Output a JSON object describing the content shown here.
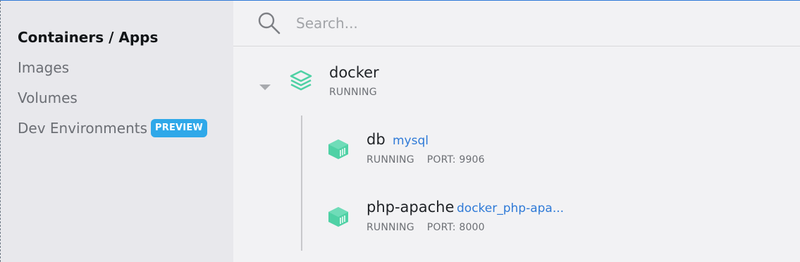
{
  "sidebar": {
    "items": [
      {
        "label": "Containers / Apps",
        "active": true
      },
      {
        "label": "Images",
        "active": false
      },
      {
        "label": "Volumes",
        "active": false
      },
      {
        "label": "Dev Environments",
        "active": false,
        "badge": "PREVIEW"
      }
    ]
  },
  "search": {
    "placeholder": "Search...",
    "icon": "search-icon"
  },
  "app": {
    "name": "docker",
    "status": "RUNNING",
    "icon": "stack-icon",
    "expanded": true,
    "containers": [
      {
        "name": "db",
        "image": "mysql",
        "status": "RUNNING",
        "port": "PORT: 9906"
      },
      {
        "name": "php-apache",
        "image": "docker_php-apa...",
        "status": "RUNNING",
        "port": "PORT: 8000"
      }
    ]
  },
  "colors": {
    "accent": "#2f7ad7",
    "badge": "#2fa8e9",
    "running_icon": "#4fd1a5",
    "sidebar_bg": "#e8e8ec",
    "main_bg": "#f2f2f4"
  }
}
